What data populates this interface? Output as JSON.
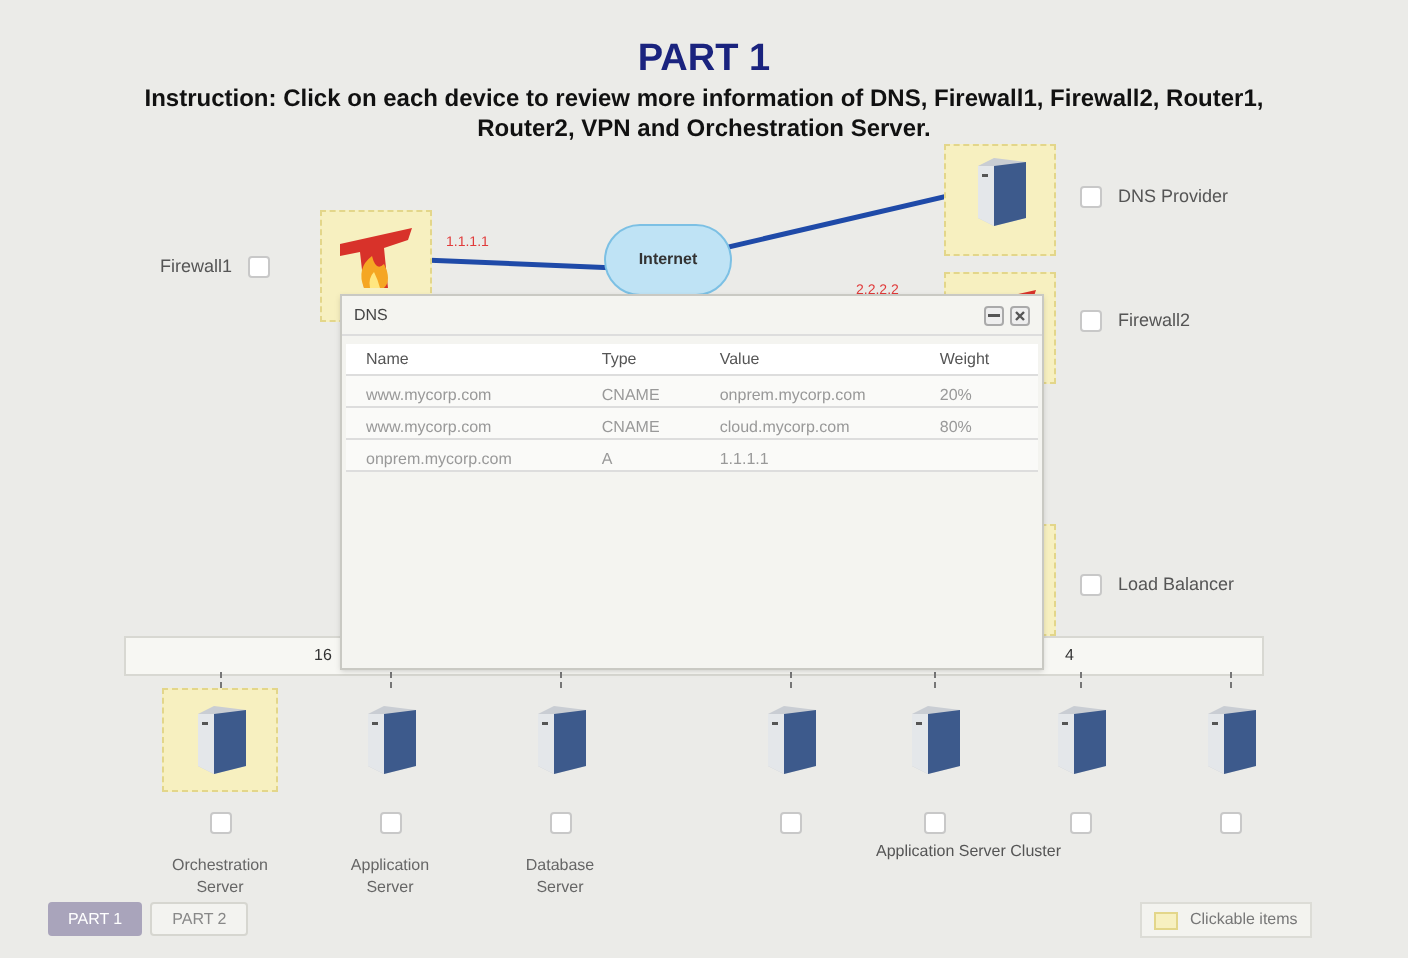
{
  "title": "PART 1",
  "instruction": "Instruction: Click on each device to review more information of DNS, Firewall1, Firewall2, Router1, Router2, VPN and Orchestration Server.",
  "network": {
    "label": "Internet"
  },
  "top_devices": [
    {
      "label": "Firewall1",
      "kind": "firewall",
      "ip": "1.1.1.1",
      "checked": false
    },
    {
      "label": "DNS Provider",
      "kind": "server",
      "checked": false
    },
    {
      "label": "Firewall2",
      "kind": "firewall",
      "ip": "2.2.2.2",
      "checked": false
    },
    {
      "label": "Load Balancer",
      "kind": "hidden",
      "checked": false
    }
  ],
  "switch_labels": [
    "16",
    "4"
  ],
  "servers": [
    {
      "label": "Orchestration Server",
      "clickable": true,
      "checked": false
    },
    {
      "label": "Application Server",
      "clickable": false,
      "checked": false
    },
    {
      "label": "Database Server",
      "clickable": false,
      "checked": false
    },
    {
      "clickable": false,
      "checked": false
    },
    {
      "clickable": false,
      "checked": false
    },
    {
      "clickable": false,
      "checked": false
    },
    {
      "clickable": false,
      "checked": false
    }
  ],
  "cluster_label": "Application Server Cluster",
  "dns_window": {
    "title": "DNS",
    "columns": [
      "Name",
      "Type",
      "Value",
      "Weight"
    ],
    "rows": [
      [
        "www.mycorp.com",
        "CNAME",
        "onprem.mycorp.com",
        "20%"
      ],
      [
        "www.mycorp.com",
        "CNAME",
        "cloud.mycorp.com",
        "80%"
      ],
      [
        "onprem.mycorp.com",
        "A",
        "1.1.1.1",
        ""
      ]
    ]
  },
  "tabs": [
    {
      "label": "PART 1",
      "selected": true
    },
    {
      "label": "PART 2",
      "selected": false
    }
  ],
  "legend": "Clickable items"
}
